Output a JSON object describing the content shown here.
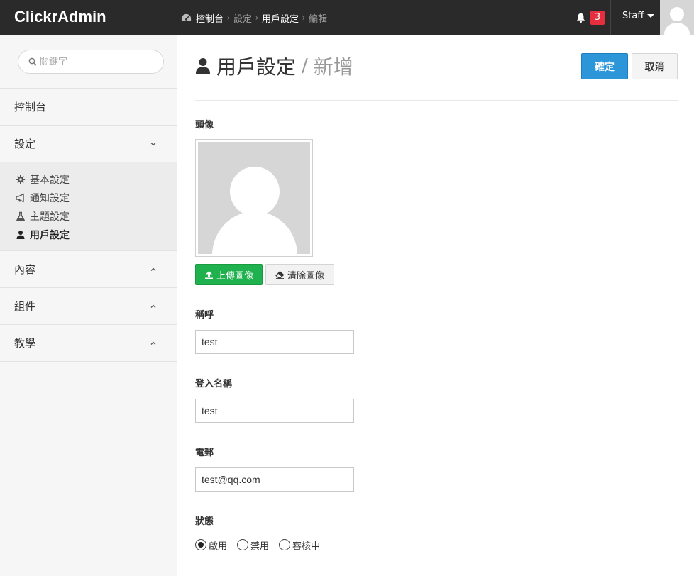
{
  "header": {
    "brand": "ClickrAdmin",
    "breadcrumb": [
      "控制台",
      "設定",
      "用戶設定",
      "編輯"
    ],
    "notification_count": "3",
    "user_menu": "Staff"
  },
  "sidebar": {
    "search_placeholder": "關鍵字",
    "items": [
      {
        "label": "控制台"
      },
      {
        "label": "設定"
      },
      {
        "label": "內容"
      },
      {
        "label": "組件"
      },
      {
        "label": "教學"
      }
    ],
    "settings_sub": [
      {
        "label": "基本設定",
        "icon": "gear-icon"
      },
      {
        "label": "通知設定",
        "icon": "bullhorn-icon"
      },
      {
        "label": "主題設定",
        "icon": "flask-icon"
      },
      {
        "label": "用戶設定",
        "icon": "user-icon"
      }
    ]
  },
  "main": {
    "title": "用戶設定",
    "subtitle": "新增",
    "confirm_label": "確定",
    "cancel_label": "取消",
    "avatar_label": "頭像",
    "upload_label": "上傳圖像",
    "clear_label": "清除圖像",
    "nickname_label": "稱呼",
    "nickname_value": "test",
    "login_label": "登入名稱",
    "login_value": "test",
    "email_label": "電郵",
    "email_value": "test@qq.com",
    "status_label": "狀態",
    "status_options": [
      "啟用",
      "禁用",
      "審核中"
    ],
    "status_selected": "啟用"
  },
  "colors": {
    "topbar": "#2a2a2a",
    "primary": "#2d96d8",
    "success": "#1fb14d",
    "badge": "#e52e3e"
  }
}
